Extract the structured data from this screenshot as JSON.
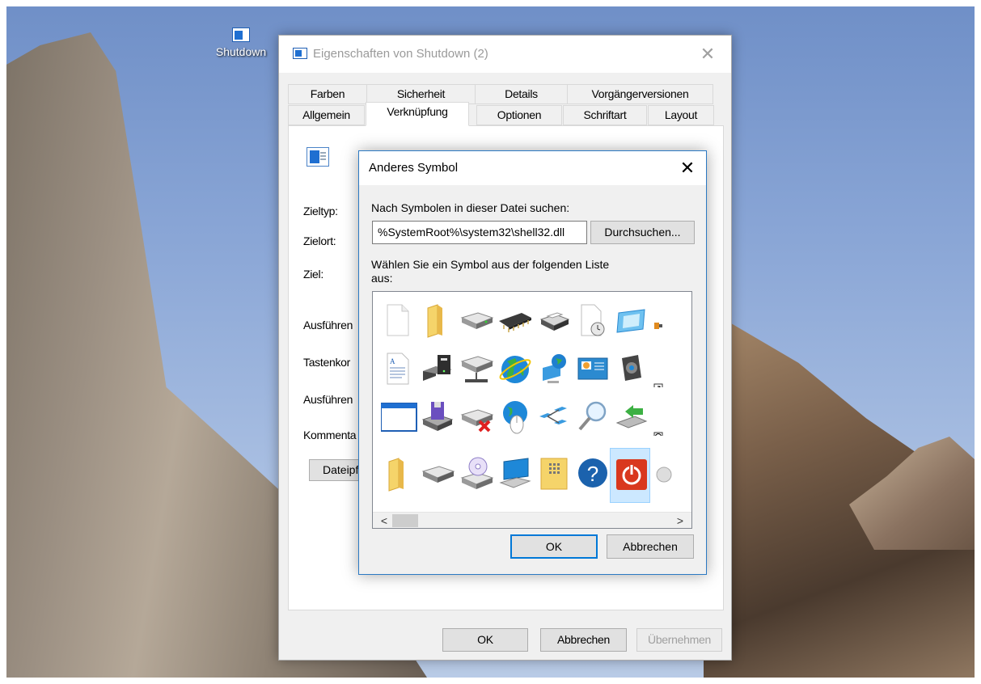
{
  "desktop": {
    "icon_label": "Shutdown"
  },
  "properties_window": {
    "title": "Eigenschaften von Shutdown (2)",
    "tabs_row1": [
      "Farben",
      "Sicherheit",
      "Details",
      "Vorgängerversionen"
    ],
    "tabs_row2": [
      "Allgemein",
      "Verknüpfung",
      "Optionen",
      "Schriftart",
      "Layout"
    ],
    "active_tab": "Verknüpfung",
    "labels": {
      "zieltyp": "Zieltyp:",
      "zielort": "Zielort:",
      "ziel": "Ziel:",
      "ausfuehren_in": "Ausführen",
      "tastenkombination": "Tastenkor",
      "ausfuehren": "Ausführen",
      "kommentar": "Kommenta"
    },
    "dateipfad_button": "Dateipfad",
    "ok_label": "OK",
    "cancel_label": "Abbrechen",
    "apply_label": "Übernehmen"
  },
  "symbol_dialog": {
    "title": "Anderes Symbol",
    "search_label": "Nach Symbolen in dieser Datei suchen:",
    "path_value": "%SystemRoot%\\system32\\shell32.dll",
    "browse_label": "Durchsuchen...",
    "list_label_line1": "Wählen Sie ein Symbol aus der folgenden Liste",
    "list_label_line2": "aus:",
    "ok_label": "OK",
    "cancel_label": "Abbrechen",
    "icons": [
      [
        "blank-document-icon",
        "folder-icon",
        "drive-icon",
        "memory-chip-icon",
        "printer-icon",
        "scheduled-document-icon",
        "display-window-icon",
        "partial-icon"
      ],
      [
        "text-document-icon",
        "computer-tower-icon",
        "network-drive-icon",
        "globe-icon",
        "network-globe-icon",
        "control-panel-icon",
        "speaker-icon",
        "shortcut-arrow-icon"
      ],
      [
        "window-icon",
        "floppy-drive-icon",
        "disconnected-drive-icon",
        "globe-mouse-icon",
        "network-icon",
        "search-icon",
        "usb-arrow-icon",
        "clock-badge-icon"
      ],
      [
        "folder-icon",
        "removable-drive-icon",
        "cd-drive-icon",
        "monitor-icon",
        "folder-grid-icon",
        "help-icon",
        "power-icon",
        "partial-disc-icon"
      ]
    ],
    "selected_icon": "power-icon"
  }
}
